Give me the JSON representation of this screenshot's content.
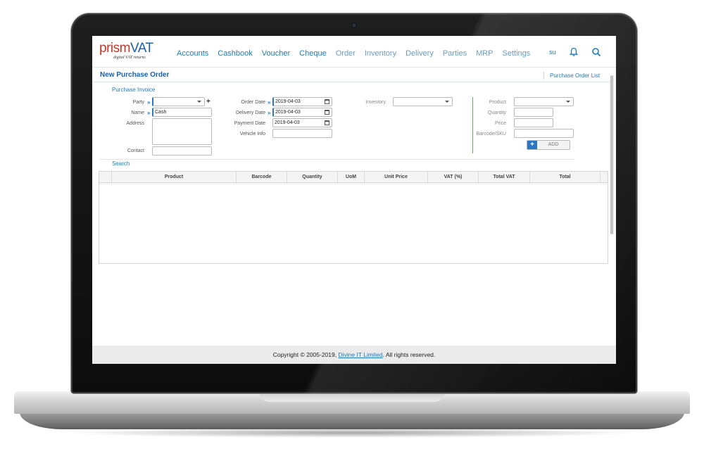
{
  "app": {
    "logo": {
      "word_prism": "prism",
      "word_vat": "VAT",
      "tagline": "digital VAT returns"
    }
  },
  "nav": {
    "items": [
      "Accounts",
      "Cashbook",
      "Voucher",
      "Cheque",
      "Order",
      "Inventory",
      "Delivery",
      "Parties",
      "MRP",
      "Settings"
    ],
    "user": "su"
  },
  "page": {
    "title": "New Purchase Order",
    "list_link": "Purchase Order List",
    "section_invoice": "Purchase Invoice",
    "section_search": "Search"
  },
  "form": {
    "party": {
      "label": "Party",
      "value": ""
    },
    "name": {
      "label": "Name",
      "value": "Cash"
    },
    "address": {
      "label": "Address",
      "value": ""
    },
    "contact": {
      "label": "Contact",
      "value": ""
    },
    "order_date": {
      "label": "Order Date",
      "value": "2019-04-03"
    },
    "delivery_date": {
      "label": "Delivery Date",
      "value": "2019-04-03"
    },
    "payment_date": {
      "label": "Payment Date",
      "value": "2019-04-03"
    },
    "vehicle_info": {
      "label": "Vehicle Info",
      "value": ""
    },
    "inventory": {
      "label": "Inventory",
      "value": ""
    },
    "product": {
      "label": "Product",
      "value": ""
    },
    "quantity": {
      "label": "Quantity",
      "value": ""
    },
    "price": {
      "label": "Price",
      "value": ""
    },
    "barcode": {
      "label": "Barcode/SKU",
      "value": ""
    },
    "add_button": "ADD"
  },
  "table": {
    "columns": [
      "Product",
      "Barcode",
      "Quantity",
      "UoM",
      "Unit Price",
      "VAT (%)",
      "Total VAT",
      "Total"
    ],
    "rows": []
  },
  "footer": {
    "prefix": "Copyright © 2005-2019, ",
    "company": "Divine IT Limited",
    "suffix": ". All rights reserved."
  },
  "colors": {
    "primary": "#1f7ab8",
    "title": "#1a5fa8",
    "divider_green": "#5cb85c",
    "footer_bg": "#ebebeb"
  }
}
